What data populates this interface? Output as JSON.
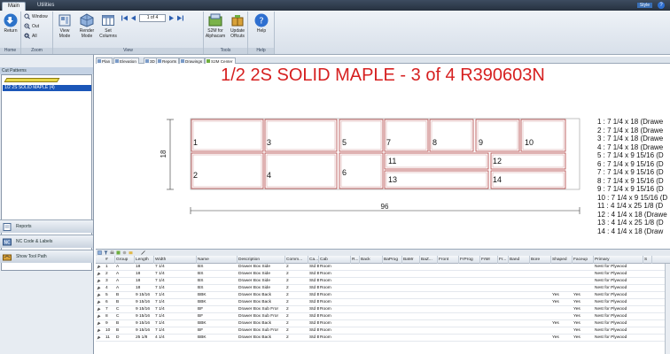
{
  "ribbon": {
    "tabs": [
      {
        "label": "Main",
        "active": true
      },
      {
        "label": "Utilities",
        "active": false
      }
    ],
    "style_label": "Style",
    "groups": {
      "home": {
        "label": "Home",
        "return_label": "Return"
      },
      "zoom": {
        "label": "Zoom",
        "window_label": "Window",
        "out_label": "Out",
        "all_label": "All"
      },
      "view": {
        "label": "View",
        "view_mode_label": "View Mode",
        "render_mode_label": "Render Mode",
        "set_columns_label": "Set Columns",
        "page_indicator": "1 of 4"
      },
      "tools": {
        "label": "Tools",
        "s2m_alphacam_label": "S2M for Alphacam",
        "update_offcuts_label": "Update Offcuts"
      },
      "help": {
        "label": "Help",
        "help_label": "Help"
      }
    }
  },
  "left_panel": {
    "header": "Cut Patterns",
    "items": [
      {
        "label": "1/2 2S SOLID MAPLE  (4)",
        "selected": true
      }
    ],
    "buttons": [
      {
        "label": "Reports"
      },
      {
        "label": "NC Code & Labels"
      },
      {
        "label": "Show Tool Path"
      }
    ]
  },
  "view_tabs": [
    "Plan",
    "Elevation",
    "3D",
    "Reports",
    "Drawings",
    "S2M Center"
  ],
  "drawing": {
    "title": "1/2 2S SOLID MAPLE  - 3 of 4 R390603N",
    "sheet_width_label": "96",
    "sheet_height_label": "18",
    "parts": [
      {
        "num": "1"
      },
      {
        "num": "2"
      },
      {
        "num": "3"
      },
      {
        "num": "4"
      },
      {
        "num": "5"
      },
      {
        "num": "6"
      },
      {
        "num": "7"
      },
      {
        "num": "8"
      },
      {
        "num": "9"
      },
      {
        "num": "10"
      },
      {
        "num": "11"
      },
      {
        "num": "12"
      },
      {
        "num": "13"
      },
      {
        "num": "14"
      }
    ],
    "legend": [
      "1 : 7 1/4 x 18 (Drawe",
      "2 : 7 1/4 x 18 (Drawe",
      "3 : 7 1/4 x 18 (Drawe",
      "4 : 7 1/4 x 18 (Drawe",
      "5 : 7 1/4 x 9 15/16 (D",
      "6 : 7 1/4 x 9 15/16 (D",
      "7 : 7 1/4 x 9 15/16 (D",
      "8 : 7 1/4 x 9 15/16 (D",
      "9 : 7 1/4 x 9 15/16 (D",
      "10 : 7 1/4 x 9 15/16 (D",
      "11 : 4 1/4 x 25 1/8 (D",
      "12 : 4 1/4 x 18 (Drawe",
      "13 : 4 1/4 x 25 1/8 (D",
      "14 : 4 1/4 x 18 (Draw"
    ]
  },
  "grid": {
    "columns": [
      "#",
      "Group",
      "Length",
      "Width",
      "Name",
      "Description",
      "Comm...",
      "Ca...",
      "Cab",
      "R...",
      "Back",
      "BaProg",
      "BaMr",
      "BaZ...",
      "Front",
      "FrProg",
      "FrMr",
      "Fr...",
      "Band",
      "Bore",
      "Shaped",
      "Faceup",
      "Primary",
      "S"
    ],
    "rows": [
      [
        "1",
        "A",
        "18",
        "7 1/4",
        "BS",
        "Drawer Box Side",
        "2",
        "Std Base",
        "Room",
        "",
        "",
        "",
        "",
        "",
        "",
        "",
        "",
        "",
        "",
        "",
        "",
        "",
        "Nest for Plywood"
      ],
      [
        "2",
        "A",
        "18",
        "7 1/4",
        "BS",
        "Drawer Box Side",
        "2",
        "Std Base",
        "Room",
        "",
        "",
        "",
        "",
        "",
        "",
        "",
        "",
        "",
        "",
        "",
        "",
        "",
        "Nest for Plywood"
      ],
      [
        "3",
        "A",
        "18",
        "7 1/4",
        "BS",
        "Drawer Box Side",
        "2",
        "Std Base",
        "Room",
        "",
        "",
        "",
        "",
        "",
        "",
        "",
        "",
        "",
        "",
        "",
        "",
        "",
        "Nest for Plywood"
      ],
      [
        "4",
        "A",
        "18",
        "7 1/4",
        "BS",
        "Drawer Box Side",
        "2",
        "Std Base",
        "Room",
        "",
        "",
        "",
        "",
        "",
        "",
        "",
        "",
        "",
        "",
        "",
        "",
        "",
        "Nest for Plywood"
      ],
      [
        "5",
        "B",
        "9 15/16",
        "7 1/4",
        "BBK",
        "Drawer Box Back",
        "2",
        "Std Base",
        "Room",
        "",
        "",
        "",
        "",
        "",
        "",
        "",
        "",
        "",
        "",
        "",
        "Yes",
        "Yes",
        "Nest for Plywood"
      ],
      [
        "6",
        "B",
        "9 15/16",
        "7 1/4",
        "BBK",
        "Drawer Box Back",
        "2",
        "Std Base",
        "Room",
        "",
        "",
        "",
        "",
        "",
        "",
        "",
        "",
        "",
        "",
        "",
        "Yes",
        "Yes",
        "Nest for Plywood"
      ],
      [
        "7",
        "C",
        "9 15/16",
        "7 1/4",
        "BF",
        "Drawer Box Sub Fror",
        "2",
        "Std Base",
        "Room",
        "",
        "",
        "",
        "",
        "",
        "",
        "",
        "",
        "",
        "",
        "",
        "",
        "Yes",
        "Nest for Plywood"
      ],
      [
        "8",
        "C",
        "9 15/16",
        "7 1/4",
        "BF",
        "Drawer Box Sub Fror",
        "2",
        "Std Base",
        "Room",
        "",
        "",
        "",
        "",
        "",
        "",
        "",
        "",
        "",
        "",
        "",
        "",
        "Yes",
        "Nest for Plywood"
      ],
      [
        "9",
        "B",
        "9 15/16",
        "7 1/4",
        "BBK",
        "Drawer Box Back",
        "2",
        "Std Base",
        "Room",
        "",
        "",
        "",
        "",
        "",
        "",
        "",
        "",
        "",
        "",
        "",
        "Yes",
        "Yes",
        "Nest for Plywood"
      ],
      [
        "10",
        "B",
        "9 15/16",
        "7 1/4",
        "BF",
        "Drawer Box Sub Fror",
        "2",
        "Std Base",
        "Room",
        "",
        "",
        "",
        "",
        "",
        "",
        "",
        "",
        "",
        "",
        "",
        "",
        "Yes",
        "Nest for Plywood"
      ],
      [
        "11",
        "D",
        "25 1/8",
        "4 1/4",
        "BBK",
        "Drawer Box Back",
        "2",
        "Std Base",
        "Room",
        "",
        "",
        "",
        "",
        "",
        "",
        "",
        "",
        "",
        "",
        "",
        "Yes",
        "Yes",
        "Nest for Plywood"
      ]
    ]
  },
  "colors": {
    "title_red": "#d62020",
    "selection_blue": "#1b56b8",
    "part_outline": "#b04040"
  }
}
